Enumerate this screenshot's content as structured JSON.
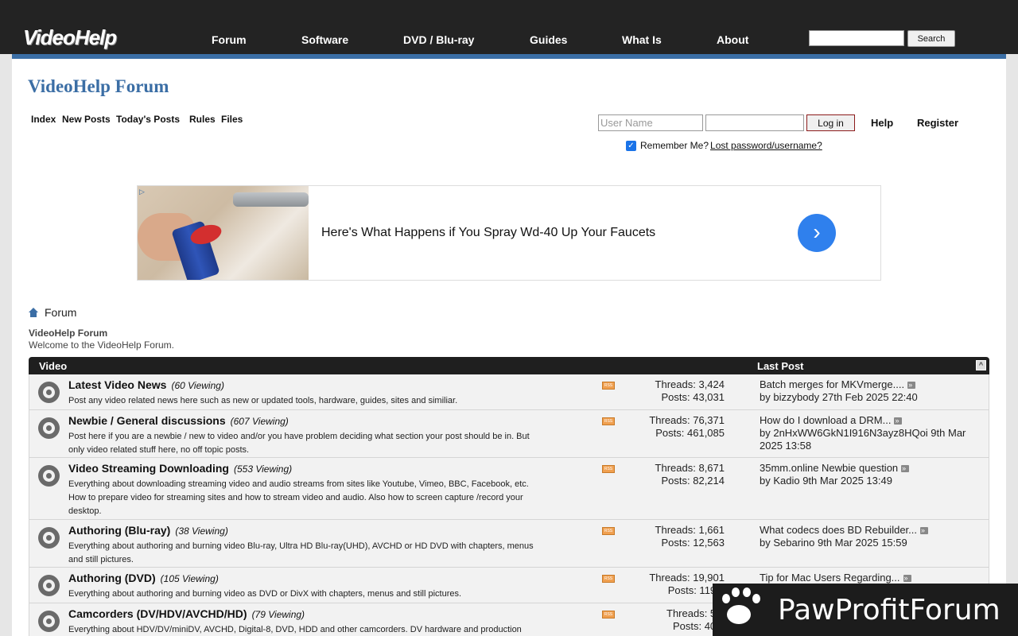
{
  "header": {
    "logo": "VideoHelp",
    "nav": [
      "Forum",
      "Software",
      "DVD / Blu-ray",
      "Guides",
      "What Is",
      "About"
    ],
    "search_button": "Search"
  },
  "forum_title": "VideoHelp Forum",
  "subnav": [
    "Index",
    "New Posts",
    "Today's Posts",
    "Rules",
    "Files"
  ],
  "login": {
    "username_placeholder": "User Name",
    "login_button": "Log in",
    "help": "Help",
    "register": "Register",
    "remember": "Remember Me?",
    "lost_password": "Lost password/username?"
  },
  "ad": {
    "text": "Here's What Happens if You Spray Wd-40 Up Your Faucets",
    "arrow": "›"
  },
  "breadcrumb": "Forum",
  "section": {
    "title": "VideoHelp Forum",
    "desc": "Welcome to the VideoHelp Forum."
  },
  "table": {
    "head_video": "Video",
    "head_last_post": "Last Post",
    "rows": [
      {
        "name": "Latest Video News",
        "viewing": "(60 Viewing)",
        "desc": "Post any video related news here such as new or updated tools, hardware, guides, sites and similiar.",
        "threads": "Threads: 3,424",
        "posts": "Posts: 43,031",
        "last_title": "Batch merges for MKVmerge....",
        "last_by": "by bizzybody 27th Feb 2025 22:40"
      },
      {
        "name": "Newbie / General discussions",
        "viewing": "(607 Viewing)",
        "desc": "Post here if you are a newbie / new to video and/or you have problem deciding what section your post should be in. But only video related stuff here, no off topic posts.",
        "threads": "Threads: 76,371",
        "posts": "Posts: 461,085",
        "last_title": "How do I download a DRM...",
        "last_by": "by 2nHxWW6GkN1I916N3ayz8HQoi 9th Mar 2025 13:58"
      },
      {
        "name": "Video Streaming Downloading",
        "viewing": "(553 Viewing)",
        "desc": "Everything about downloading streaming video and audio streams from sites like Youtube, Vimeo, BBC, Facebook, etc. How to prepare video for streaming sites and how to stream video and audio. Also how to screen capture /record your desktop.",
        "threads": "Threads: 8,671",
        "posts": "Posts: 82,214",
        "last_title": "35mm.online Newbie question",
        "last_by": "by Kadio 9th Mar 2025 13:49"
      },
      {
        "name": "Authoring (Blu-ray)",
        "viewing": "(38 Viewing)",
        "desc": "Everything about authoring and burning video Blu-ray, Ultra HD Blu-ray(UHD), AVCHD or HD DVD with chapters, menus and still pictures.",
        "threads": "Threads: 1,661",
        "posts": "Posts: 12,563",
        "last_title": "What codecs does BD Rebuilder...",
        "last_by": "by Sebarino 9th Mar 2025 15:59"
      },
      {
        "name": "Authoring (DVD)",
        "viewing": "(105 Viewing)",
        "desc": "Everything about authoring and burning video as DVD or DivX with chapters, menus and still pictures.",
        "threads": "Threads: 19,901",
        "posts": "Posts: 119,6",
        "last_title": "Tip for Mac Users Regarding...",
        "last_by": ""
      },
      {
        "name": "Camcorders (DV/HDV/AVCHD/HD)",
        "viewing": "(79 Viewing)",
        "desc": "Everything about HDV/DV/miniDV, AVCHD, Digital-8, DVD, HDD and other camcorders. DV hardware and production",
        "threads": "Threads: 5,4",
        "posts": "Posts: 40,0",
        "last_title": "",
        "last_by": ""
      }
    ]
  },
  "watermark": "PawProfitForum"
}
